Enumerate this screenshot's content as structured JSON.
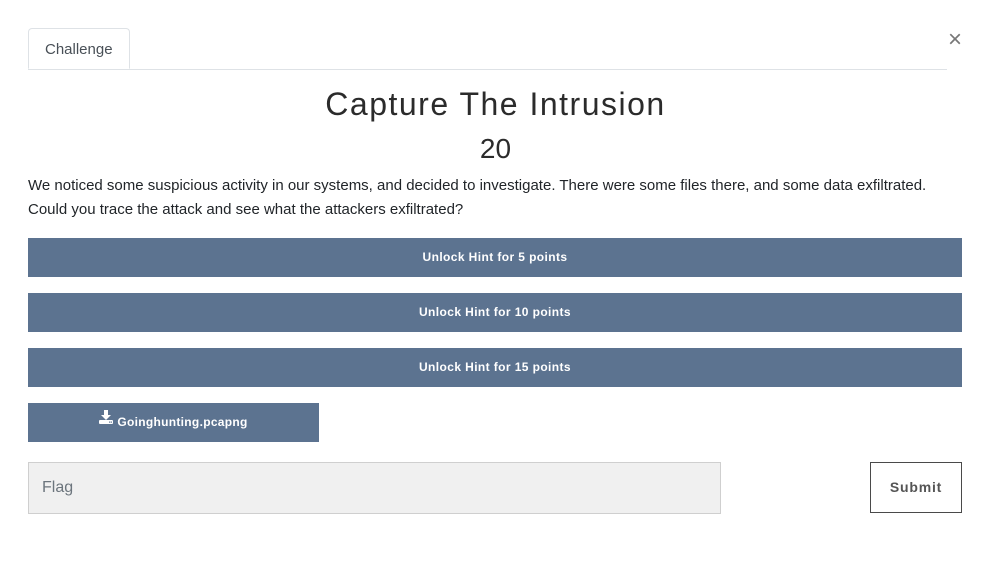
{
  "tabs": [
    {
      "label": "Challenge"
    }
  ],
  "close_label": "×",
  "challenge": {
    "name": "Capture The Intrusion",
    "value": "20",
    "description": "We noticed some suspicious activity in our systems, and decided to investigate. There were some files there, and some data exfiltrated. Could you trace the attack and see what the attackers exfiltrated?"
  },
  "hints": [
    {
      "label": "Unlock Hint for 5 points"
    },
    {
      "label": "Unlock Hint for 10 points"
    },
    {
      "label": "Unlock Hint for 15 points"
    }
  ],
  "file": {
    "icon": "download-icon",
    "name": "Goinghunting.pcapng"
  },
  "flag_form": {
    "placeholder": "Flag",
    "value": "",
    "submit_label": "Submit"
  },
  "colors": {
    "button_bg": "#5c7390",
    "input_bg": "#f0f0f0"
  }
}
